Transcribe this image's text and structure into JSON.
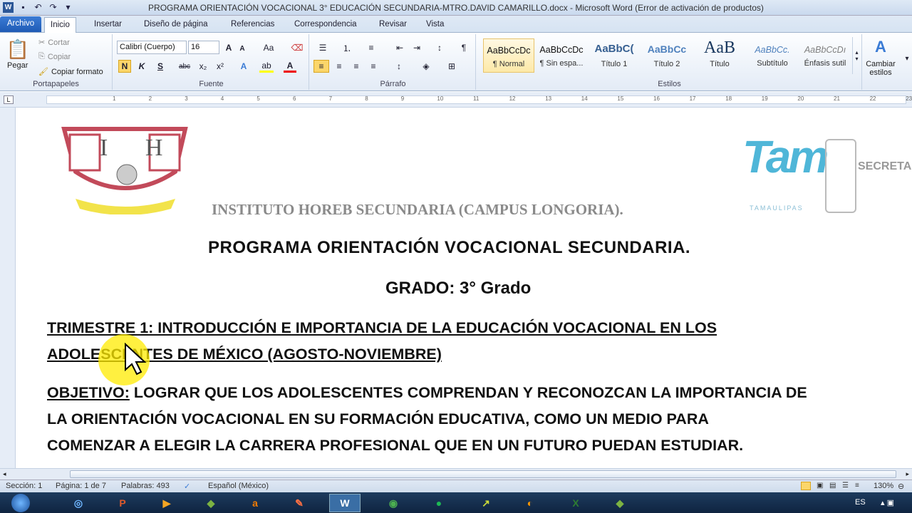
{
  "window": {
    "title": "PROGRAMA ORIENTACIÓN VOCACIONAL 3° EDUCACIÓN SECUNDARIA-MTRO.DAVID CAMARILLO.docx  -  Microsoft Word (Error de activación de productos)"
  },
  "ribbon_tabs": [
    "Archivo",
    "Inicio",
    "Insertar",
    "Diseño de página",
    "Referencias",
    "Correspondencia",
    "Revisar",
    "Vista"
  ],
  "clipboard": {
    "paste": "Pegar",
    "cut": "Cortar",
    "copy": "Copiar",
    "format_painter": "Copiar formato",
    "label": "Portapapeles"
  },
  "font": {
    "name": "Calibri (Cuerpo)",
    "size": "16",
    "label": "Fuente",
    "bold": "N",
    "italic": "K",
    "underline": "S",
    "strike": "abc",
    "sub": "x₂",
    "sup": "x²",
    "case": "Aa"
  },
  "paragraph": {
    "label": "Párrafo"
  },
  "styles": {
    "label": "Estilos",
    "items": [
      {
        "preview": "AaBbCcDc",
        "name": "¶ Normal"
      },
      {
        "preview": "AaBbCcDc",
        "name": "¶ Sin espa..."
      },
      {
        "preview": "AaBbC(",
        "name": "Título 1"
      },
      {
        "preview": "AaBbCc",
        "name": "Título 2"
      },
      {
        "preview": "AaB",
        "name": "Título"
      },
      {
        "preview": "AaBbCc.",
        "name": "Subtítulo"
      },
      {
        "preview": "AaBbCcDı",
        "name": "Énfasis sutil"
      }
    ],
    "change": "Cambiar estilos"
  },
  "ruler_ticks": [
    "1",
    "2",
    "3",
    "4",
    "5",
    "6",
    "7",
    "8",
    "9",
    "10",
    "11",
    "12",
    "13",
    "14",
    "15",
    "16",
    "17",
    "18",
    "19",
    "20",
    "21",
    "22",
    "23"
  ],
  "document": {
    "logo_left_letters": "I H",
    "logo_right_text": "Tam",
    "logo_right_sub": "TAMAULIPAS",
    "logo_right_org": "SECRETARÍA DE EDUCACIÓN",
    "school": "INSTITUTO HOREB SECUNDARIA (CAMPUS LONGORIA).",
    "program": "PROGRAMA ORIENTACIÓN VOCACIONAL SECUNDARIA.",
    "grade": "GRADO: 3° Grado",
    "trimestre_line1": "TRIMESTRE 1: INTRODUCCIÓN E IMPORTANCIA DE LA EDUCACIÓN VOCACIONAL EN LOS",
    "trimestre_line2": "ADOLESCENTES DE MÉXICO   (AGOSTO-NOVIEMBRE)",
    "objetivo_label": "OBJETIVO:",
    "objetivo_line1": " LOGRAR QUE LOS ADOLESCENTES COMPRENDAN Y RECONOZCAN LA IMPORTANCIA DE",
    "objetivo_line2": "LA ORIENTACIÓN VOCACIONAL EN SU FORMACIÓN EDUCATIVA, COMO UN MEDIO PARA",
    "objetivo_line3": "COMENZAR A ELEGIR LA CARRERA PROFESIONAL QUE EN UN FUTURO PUEDAN ESTUDIAR."
  },
  "status": {
    "section": "Sección: 1",
    "page": "Página: 1 de 7",
    "words": "Palabras: 493",
    "language": "Español (México)",
    "zoom": "130%"
  },
  "taskbar": {
    "lang": "ES"
  }
}
